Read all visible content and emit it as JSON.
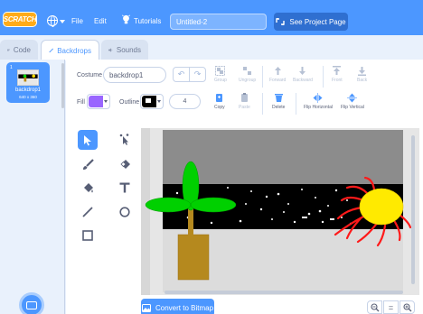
{
  "menubar": {
    "logo_text": "SCRATCH",
    "file_label": "File",
    "edit_label": "Edit",
    "tutorials_label": "Tutorials",
    "project_title": "Untitled-2",
    "see_project_label": "See Project Page"
  },
  "tabs": [
    {
      "label": "Code"
    },
    {
      "label": "Backdrops"
    },
    {
      "label": "Sounds"
    }
  ],
  "backdrop_list": {
    "items": [
      {
        "number": "1",
        "name": "backdrop1",
        "size": "640 x 360"
      }
    ]
  },
  "editor": {
    "costume_label": "Costume",
    "costume_name": "backdrop1",
    "toolbar": {
      "group_label": "Group",
      "ungroup_label": "Ungroup",
      "forward_label": "Forward",
      "backward_label": "Backward",
      "front_label": "Front",
      "back_label": "Back",
      "copy_label": "Copy",
      "paste_label": "Paste",
      "delete_label": "Delete",
      "flip_h_label": "Flip Horizontal",
      "flip_v_label": "Flip Vertical"
    },
    "fill_label": "Fill",
    "fill_color": "#9966ff",
    "outline_label": "Outline",
    "outline_color": "#000000",
    "stroke_width": "4",
    "convert_label": "Convert to Bitmap",
    "zoom_reset_label": "="
  },
  "colors": {
    "accent": "#4c97ff",
    "menubar": "#4c97ff",
    "logo": "#ffab19"
  }
}
